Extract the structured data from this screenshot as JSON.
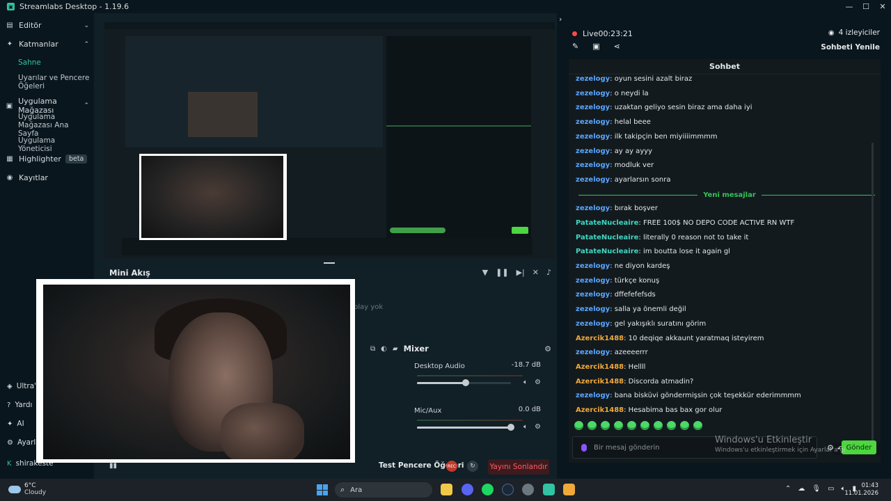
{
  "window": {
    "title": "Streamlabs Desktop - 1.19.6"
  },
  "sidebar": {
    "editor": "Editör",
    "layers": "Katmanlar",
    "scene": "Sahne",
    "apps_windows": "Uyarılar ve Pencere Öğeleri",
    "app_store": "Uygulama Mağazası",
    "app_store_home": "Uygulama Mağazası Ana Sayfa",
    "app_manager": "Uygulama Yöneticisi",
    "highlighter": "Highlighter",
    "beta": "beta",
    "recordings": "Kayıtlar",
    "ultra": "Ultra'y",
    "help": "Yardı",
    "ai": "AI",
    "settings": "Ayarla",
    "user": "shirakeste"
  },
  "main": {
    "mini_feed_title": "Mini Akış",
    "replay_text": "play yok",
    "mixer_title": "Mixer",
    "mixer": [
      {
        "name": "Desktop Audio",
        "value": "-18.7 dB",
        "level": 0.52
      },
      {
        "name": "Mic/Aux",
        "value": "0.0 dB",
        "level": 1.0
      }
    ],
    "test_label": "Test Pencere Öğeleri",
    "rec_label": "REC",
    "end_stream": "Yayını Sonlandır"
  },
  "right_panel": {
    "live_label": "Live",
    "live_time": "00:23:21",
    "viewers": "4 izleyiciler",
    "refresh_chat": "Sohbeti Yenile",
    "chat_title": "Sohbet",
    "new_messages": "Yeni mesajlar",
    "input_placeholder": "Bir mesaj gönderin",
    "send": "Gönder",
    "watermark_title": "Windows'u Etkinleştir",
    "watermark_sub": "Windows'u etkinleştirmek için Ayarlar'a gi",
    "messages": [
      {
        "user": "zezelogy",
        "text": ": oyun sesini azalt biraz",
        "color": "blue"
      },
      {
        "user": "zezelogy",
        "text": ": o neydi la",
        "color": "blue"
      },
      {
        "user": "zezelogy",
        "text": ": uzaktan geliyo sesin biraz ama daha iyi",
        "color": "blue"
      },
      {
        "user": "zezelogy",
        "text": ": helal beee",
        "color": "blue"
      },
      {
        "user": "zezelogy",
        "text": ": ilk takipçin ben miyiiiimmmm",
        "color": "blue"
      },
      {
        "user": "zezelogy",
        "text": ": ay ay ayyy",
        "color": "blue"
      },
      {
        "user": "zezelogy",
        "text": ": modluk ver",
        "color": "blue"
      },
      {
        "user": "zezelogy",
        "text": ": ayarlarsın sonra",
        "color": "blue"
      }
    ],
    "messages_new": [
      {
        "user": "zezelogy",
        "text": ": bırak boşver",
        "color": "blue"
      },
      {
        "user": "PatateNucleaire",
        "text": ": FREE 100$ NO DEPO CODE ACTIVE RN WTF",
        "color": "teal"
      },
      {
        "user": "PatateNucleaire",
        "text": ": literally 0 reason not to take it",
        "color": "teal"
      },
      {
        "user": "PatateNucleaire",
        "text": ": im boutta lose it again gl",
        "color": "teal"
      },
      {
        "user": "zezelogy",
        "text": ": ne diyon kardeş",
        "color": "blue"
      },
      {
        "user": "zezelogy",
        "text": ": türkçe konuş",
        "color": "blue"
      },
      {
        "user": "zezelogy",
        "text": ": dffefefefsds",
        "color": "blue"
      },
      {
        "user": "zezelogy",
        "text": ": salla ya önemli değil",
        "color": "blue"
      },
      {
        "user": "zezelogy",
        "text": ": gel yakışıklı suratını görim",
        "color": "blue"
      },
      {
        "user": "Azercik1488",
        "text": ": 10 deqiqe akkaunt yaratmaq isteyirem",
        "color": "orange"
      },
      {
        "user": "zezelogy",
        "text": ": azeeeerrr",
        "color": "blue"
      },
      {
        "user": "Azercik1488",
        "text": ": Hellll",
        "color": "orange"
      },
      {
        "user": "Azercik1488",
        "text": ": Discorda atmadin?",
        "color": "orange"
      },
      {
        "user": "zezelogy",
        "text": ": bana bisküvi göndermişsin çok teşekkür ederimmmm",
        "color": "blue"
      },
      {
        "user": "Azercik1488",
        "text": ": Hesabima bas bax gor olur",
        "color": "orange"
      }
    ]
  },
  "taskbar": {
    "temp": "6°C",
    "weather": "Cloudy",
    "search": "Ara",
    "time": "01:43",
    "date": "11.01.2026"
  },
  "colors": {
    "accent": "#31c3a2",
    "user_blue": "#5aa6ff",
    "user_teal": "#3fd6c0",
    "user_orange": "#f0a93a",
    "send_green": "#4cd63f",
    "end_red": "#ff5a62"
  }
}
